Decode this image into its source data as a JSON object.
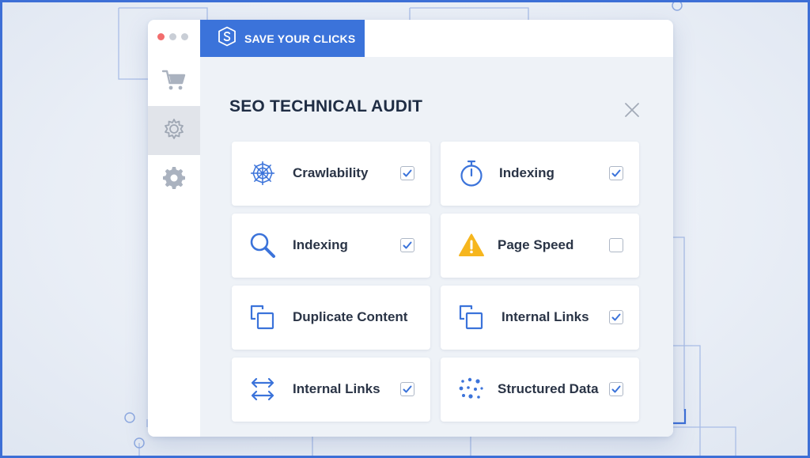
{
  "app": {
    "brand_label": "SAVE YOUR CLICKS",
    "brand_icon": "s-shield-logo-icon",
    "accent_color": "#3b73da"
  },
  "window_controls": [
    "close-dot",
    "minimize-dot",
    "maximize-dot"
  ],
  "sidebar": {
    "items": [
      {
        "name": "cart",
        "icon": "cart-icon",
        "active": false
      },
      {
        "name": "settings-gear",
        "icon": "gear-icon",
        "active": true
      },
      {
        "name": "settings-cog",
        "icon": "cog-icon",
        "active": false
      }
    ]
  },
  "panel": {
    "title": "SEO TECHNICAL AUDIT",
    "close_icon": "close-icon"
  },
  "audit_items": [
    {
      "label": "Crawlability",
      "icon": "spider-web-icon",
      "checked": true
    },
    {
      "label": "Indexing",
      "icon": "stopwatch-icon",
      "checked": true
    },
    {
      "label": "Indexing",
      "icon": "magnifier-icon",
      "checked": true
    },
    {
      "label": "Page Speed",
      "icon": "warning-icon",
      "checked": false
    },
    {
      "label": "Duplicate Content",
      "icon": "duplicate-icon",
      "checked": true
    },
    {
      "label": "Internal Links",
      "icon": "duplicate-icon",
      "checked": true
    },
    {
      "label": "Internal Links",
      "icon": "arrows-horizontal-icon",
      "checked": true
    },
    {
      "label": "Structured Data",
      "icon": "dots-grid-icon",
      "checked": true
    }
  ]
}
